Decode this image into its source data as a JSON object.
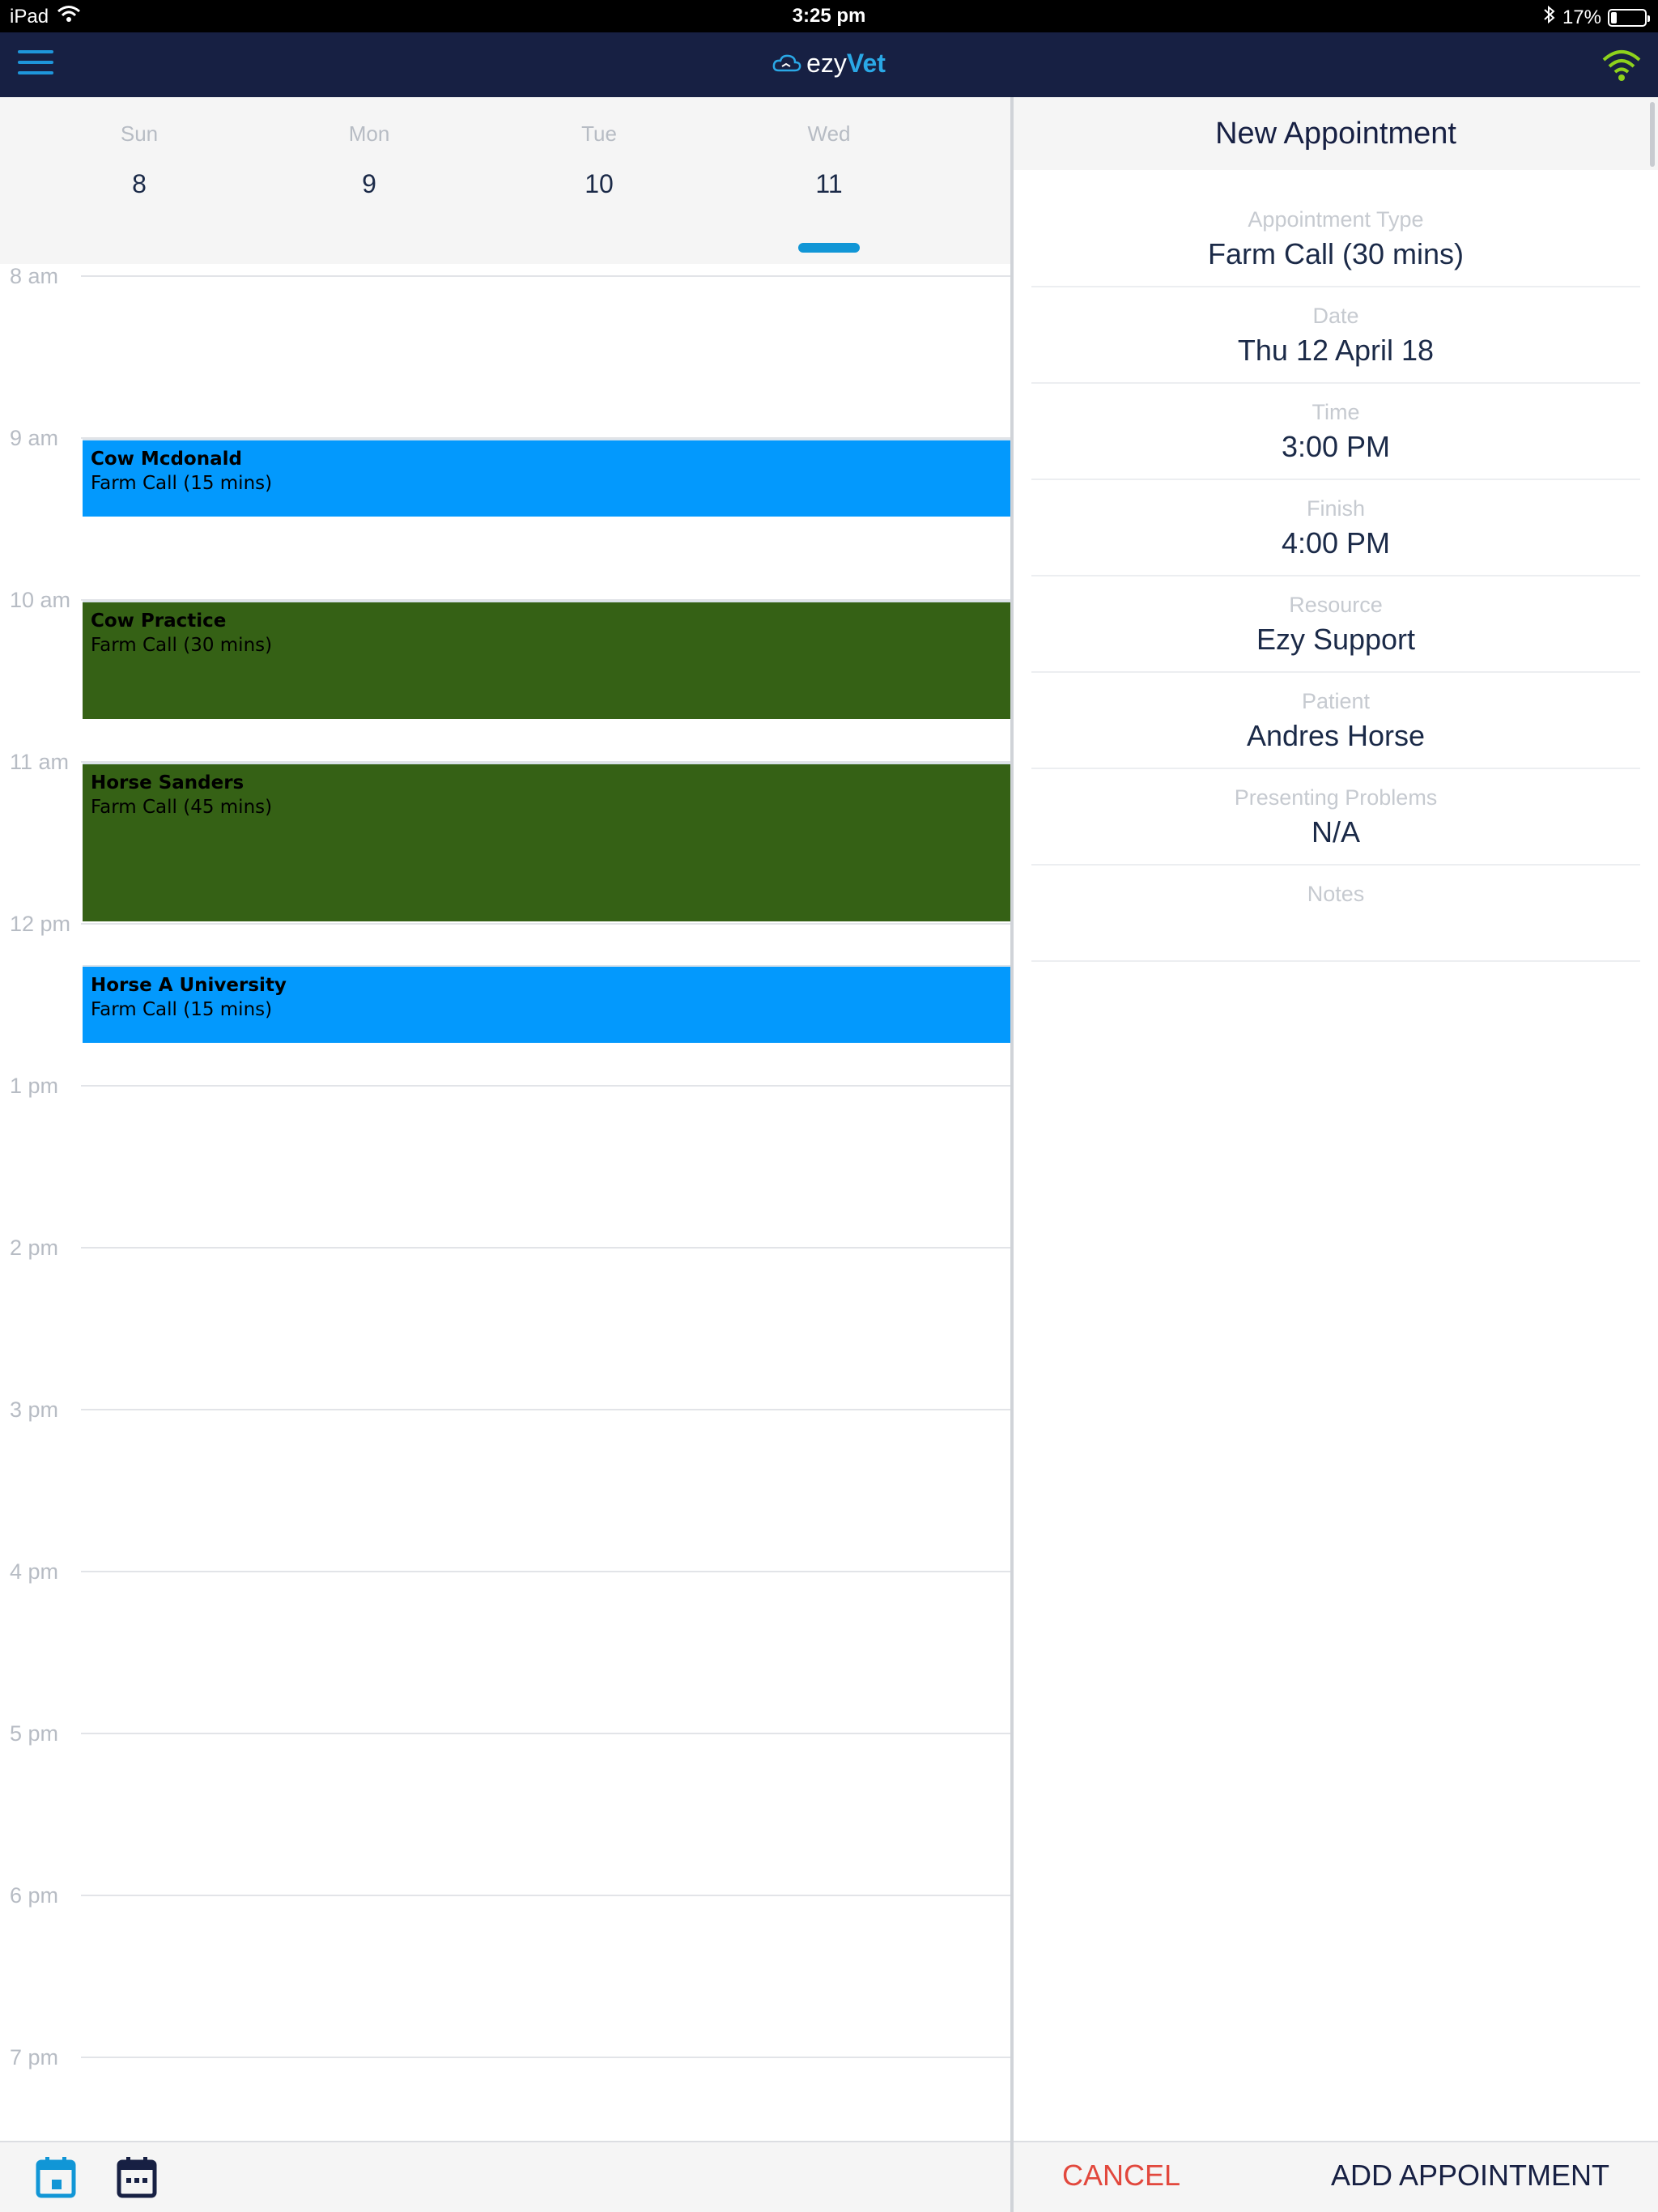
{
  "status_bar": {
    "device": "iPad",
    "time": "3:25 pm",
    "battery": "17%",
    "battery_level": 0.17
  },
  "header": {
    "brand_prefix": "ezy",
    "brand_suffix": "Vet"
  },
  "days": [
    {
      "name": "Sun",
      "number": "8"
    },
    {
      "name": "Mon",
      "number": "9"
    },
    {
      "name": "Tue",
      "number": "10"
    },
    {
      "name": "Wed",
      "number": "11"
    }
  ],
  "hours": [
    "8 am",
    "9 am",
    "10 am",
    "11 am",
    "12 pm",
    "1 pm",
    "2 pm",
    "3 pm",
    "4 pm",
    "5 pm",
    "6 pm",
    "7 pm"
  ],
  "appointments": [
    {
      "name": "Cow Mcdonald",
      "type": "Farm Call (15 mins)"
    },
    {
      "name": "Cow Practice",
      "type": "Farm Call (30 mins)"
    },
    {
      "name": "Horse Sanders",
      "type": "Farm Call (45 mins)"
    },
    {
      "name": "Horse A University",
      "type": "Farm Call (15 mins)"
    }
  ],
  "form": {
    "title": "New Appointment",
    "fields": [
      {
        "label": "Appointment Type",
        "value": "Farm Call (30 mins)"
      },
      {
        "label": "Date",
        "value": "Thu 12 April 18"
      },
      {
        "label": "Time",
        "value": "3:00 PM"
      },
      {
        "label": "Finish",
        "value": "4:00 PM"
      },
      {
        "label": "Resource",
        "value": "Ezy Support"
      },
      {
        "label": "Patient",
        "value": "Andres Horse"
      },
      {
        "label": "Presenting Problems",
        "value": "N/A"
      },
      {
        "label": "Notes",
        "value": ""
      }
    ]
  },
  "actions": {
    "cancel": "CANCEL",
    "add": "ADD APPOINTMENT"
  },
  "colors": {
    "header_bg": "#172043",
    "accent": "#1196d6",
    "appt_blue": "#0399fd",
    "appt_green": "#356115",
    "cancel_red": "#e2483d",
    "wifi_green": "#8ed21c"
  }
}
